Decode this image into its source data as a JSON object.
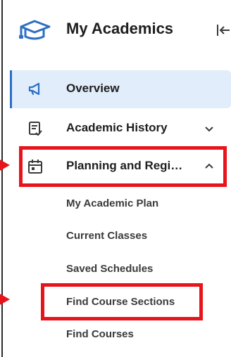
{
  "header": {
    "title": "My Academics",
    "icon": "graduation-cap-icon",
    "collapse_icon": "collapse-left-icon"
  },
  "nav": {
    "items": [
      {
        "label": "Overview",
        "icon": "megaphone-icon",
        "active": true
      },
      {
        "label": "Academic History",
        "icon": "transcript-icon",
        "chevron": "chevron-down-icon"
      },
      {
        "label": "Planning and Regi…",
        "icon": "calendar-icon",
        "chevron": "chevron-up-icon",
        "highlighted": true
      }
    ],
    "sub_items": [
      {
        "label": "My Academic Plan"
      },
      {
        "label": "Current Classes"
      },
      {
        "label": "Saved Schedules"
      },
      {
        "label": "Find Course Sections",
        "highlighted": true
      },
      {
        "label": "Find Courses"
      }
    ]
  },
  "colors": {
    "accent": "#2d6fc3",
    "active_bg": "#e1edfb",
    "highlight": "#e8141b",
    "text": "#1e1e1e"
  }
}
